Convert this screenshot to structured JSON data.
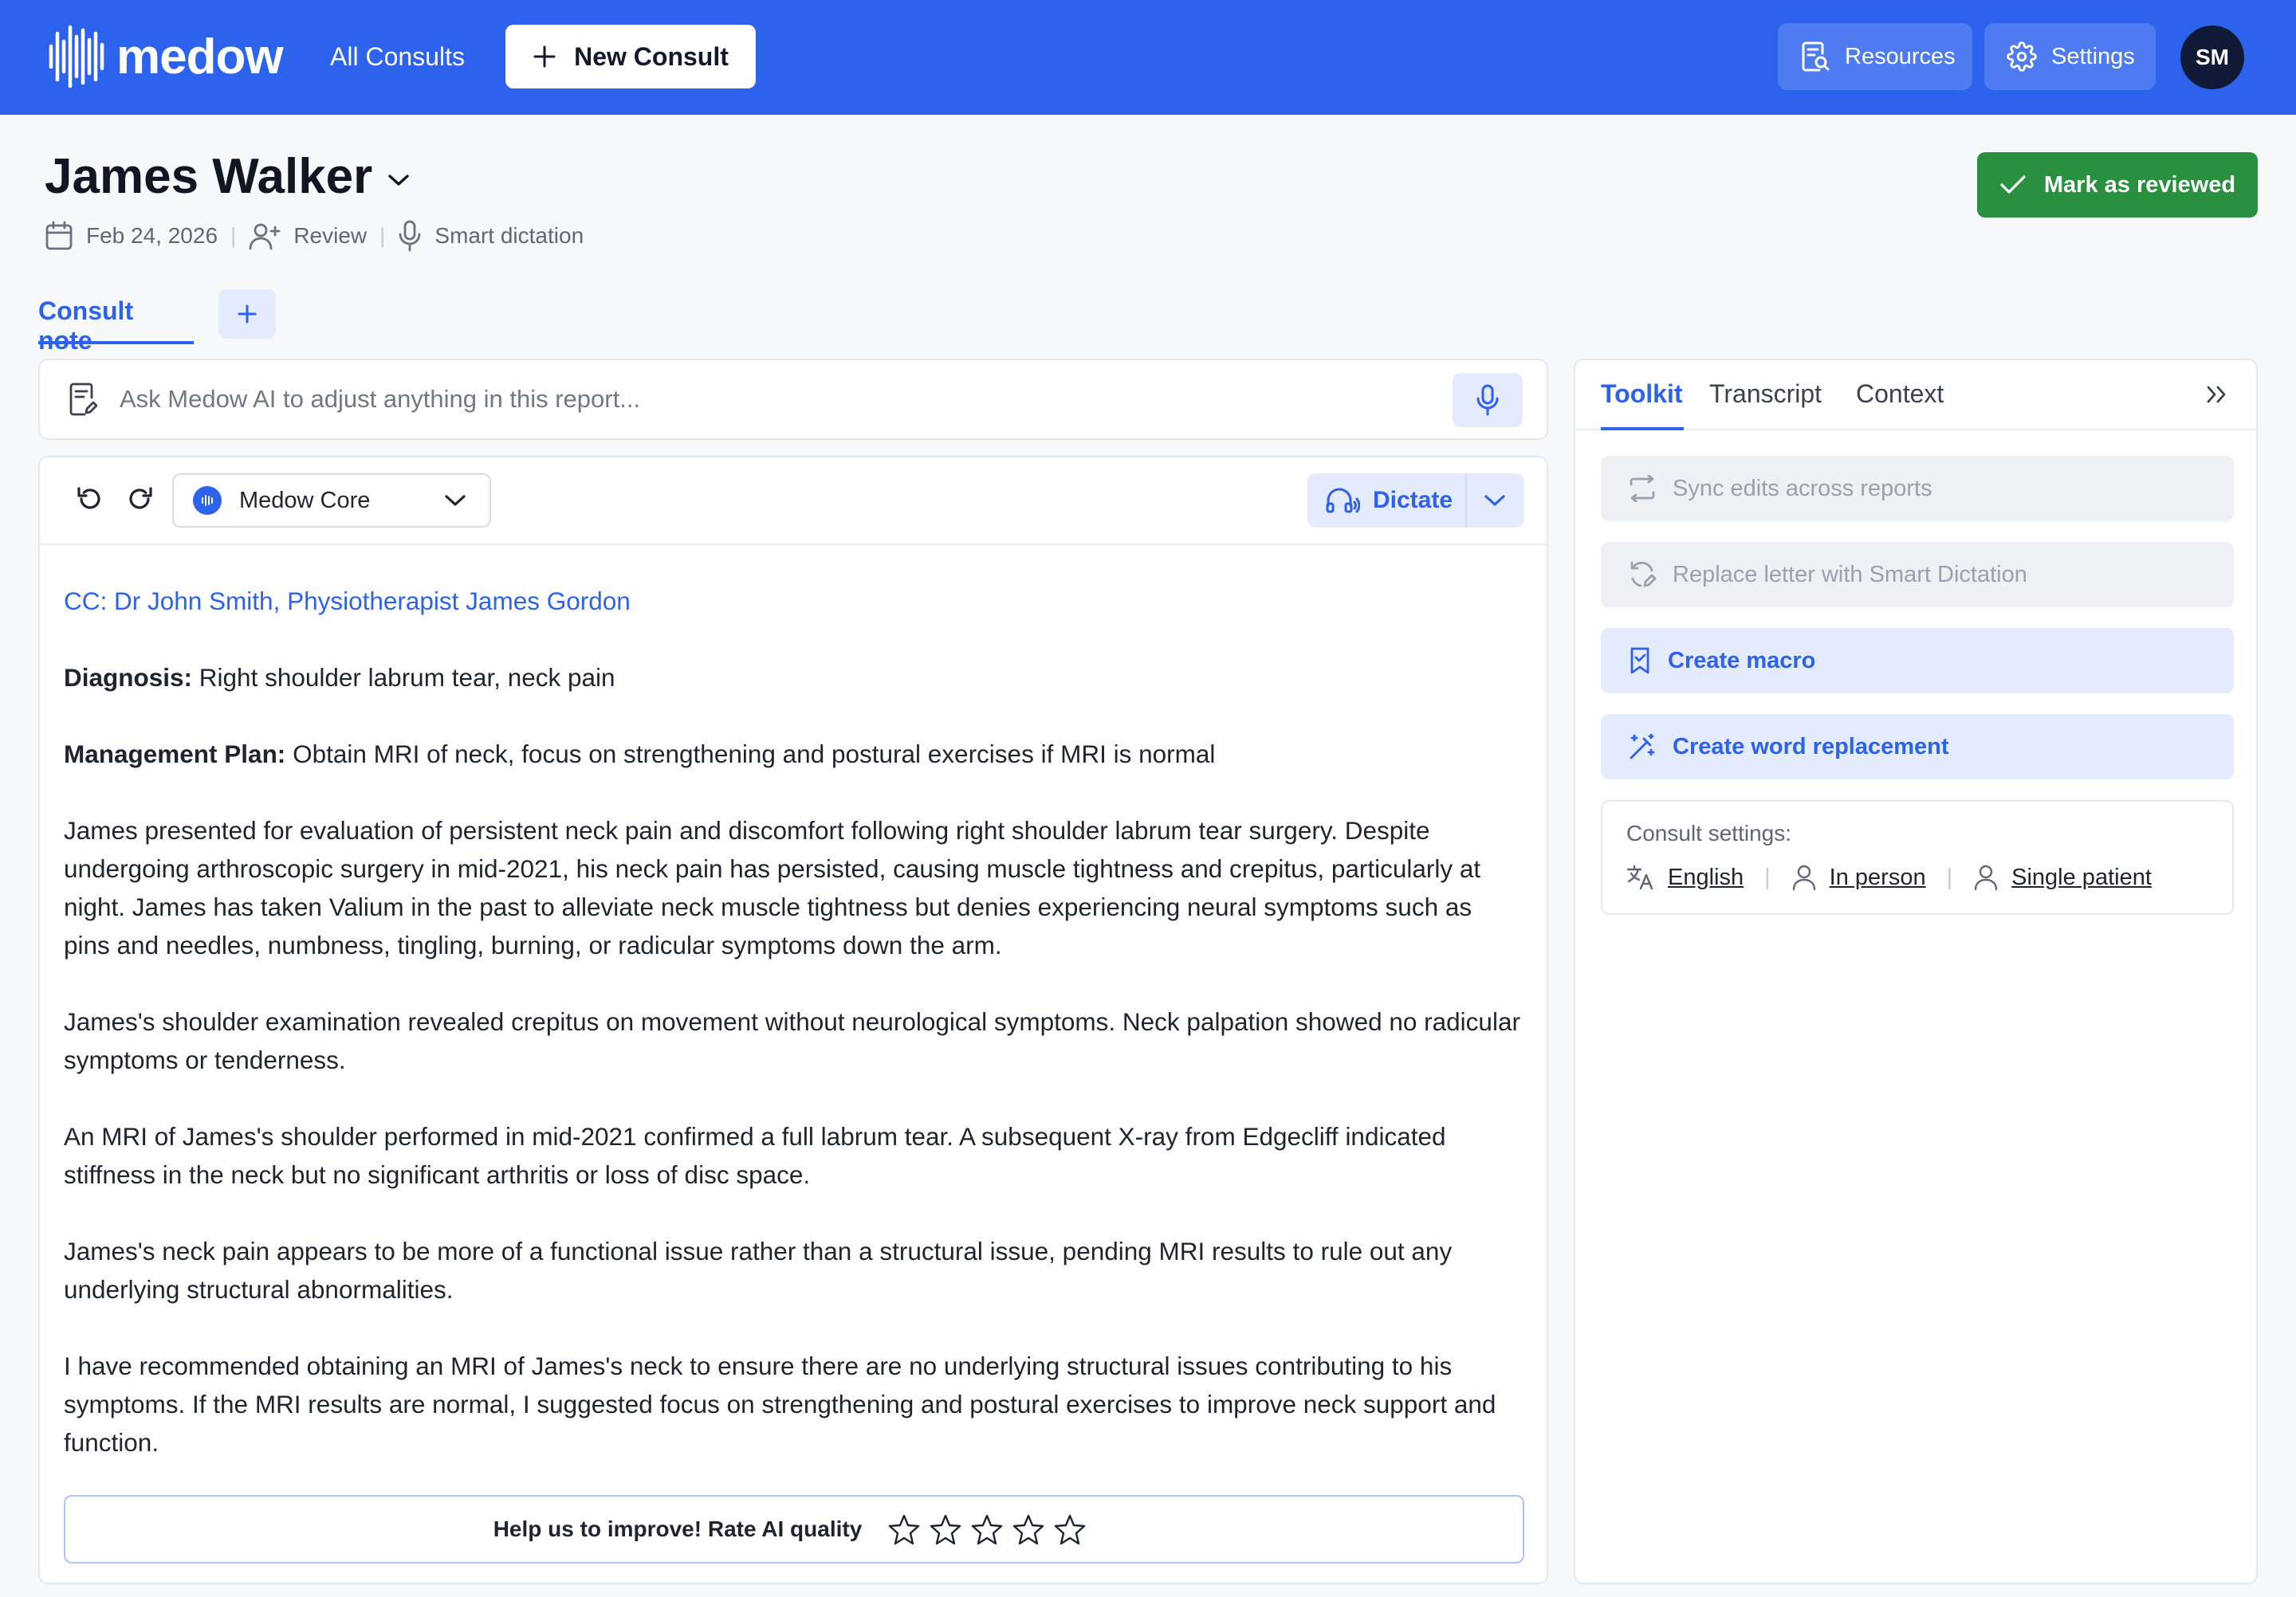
{
  "topbar": {
    "logo_text": "medow",
    "nav_all_consults": "All Consults",
    "new_consult_label": "New Consult",
    "resources_label": "Resources",
    "settings_label": "Settings",
    "avatar_initials": "SM",
    "brand_color": "#2d62ec"
  },
  "patient": {
    "name": "James Walker",
    "date": "Feb 24, 2026",
    "review_label": "Review",
    "dictation_label": "Smart dictation"
  },
  "actions": {
    "mark_reviewed_label": "Mark as reviewed"
  },
  "tabs": {
    "consult_note_label": "Consult note"
  },
  "ask_ai": {
    "placeholder": "Ask Medow AI to adjust anything in this report..."
  },
  "editor": {
    "model_name": "Medow Core",
    "dictate_label": "Dictate",
    "note": {
      "cc": "CC: Dr John Smith, Physiotherapist James Gordon",
      "diagnosis_label": "Diagnosis:",
      "diagnosis_text": " Right shoulder labrum tear, neck pain",
      "plan_label": "Management Plan:",
      "plan_text": " Obtain MRI of neck, focus on strengthening and postural exercises if MRI is normal",
      "paragraphs": [
        "James presented for evaluation of persistent neck pain and discomfort following right shoulder labrum tear surgery. Despite undergoing arthroscopic surgery in mid-2021, his neck pain has persisted, causing muscle tightness and crepitus, particularly at night. James has taken Valium in the past to alleviate neck muscle tightness but denies experiencing neural symptoms such as pins and needles, numbness, tingling, burning, or radicular symptoms down the arm.",
        "James's shoulder examination revealed crepitus on movement without neurological symptoms. Neck palpation showed no radicular symptoms or tenderness.",
        "An MRI of James's shoulder performed in mid-2021 confirmed a full labrum tear. A subsequent X-ray from Edgecliff indicated stiffness in the neck but no significant arthritis or loss of disc space.",
        "James's neck pain appears to be more of a functional issue rather than a structural issue, pending MRI results to rule out any underlying structural abnormalities.",
        "I have recommended obtaining an MRI of James's neck to ensure there are no underlying structural issues contributing to his symptoms. If the MRI results are normal, I suggested focus on strengthening and postural exercises to improve neck support and function."
      ]
    },
    "rating_prompt": "Help us to improve! Rate AI quality",
    "rating_stars": 0
  },
  "panel": {
    "tabs": [
      "Toolkit",
      "Transcript",
      "Context"
    ],
    "active_tab": "Toolkit",
    "toolkit": {
      "sync_label": "Sync edits across reports",
      "replace_label": "Replace letter with Smart Dictation",
      "macro_label": "Create macro",
      "word_replacement_label": "Create word replacement"
    },
    "consult_settings": {
      "title": "Consult settings:",
      "language": "English",
      "mode": "In person",
      "patients": "Single patient"
    }
  },
  "icons": {
    "logo": "waveform-icon",
    "new_consult": "plus-icon",
    "resources": "document-search-icon",
    "settings": "gear-icon",
    "name_dropdown": "chevron-down-icon",
    "date": "calendar-icon",
    "review": "user-plus-icon",
    "dictation": "microphone-icon",
    "reviewed": "check-icon",
    "undo": "undo-icon",
    "redo": "redo-icon",
    "dictate": "headset-icon",
    "collapse": "double-chevron-right-icon",
    "star": "star-outline-icon"
  },
  "colors": {
    "accent": "#2d62ec",
    "success": "#28903f",
    "avatar_bg": "#101a36",
    "accent_soft": "#e4ebfd"
  }
}
